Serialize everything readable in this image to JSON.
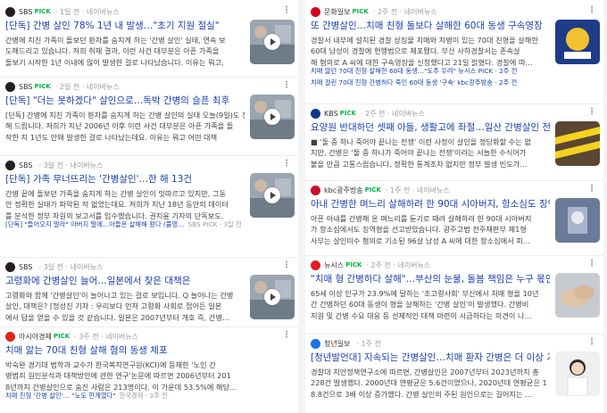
{
  "left": [
    {
      "source": "SBS",
      "pick": "PICK",
      "meta": "· 1일 전 · 네이버뉴스",
      "title": "[단독] 간병 살인 78% 1년 내 발생…\"초기 지원 절실\"",
      "lines": [
        "간병에 지친 가족이 돌보던 환자를 숨지게 하는 '간병 살인' 실태, 연속 보",
        "도해드리고 있습니다. 저희 취재 결과, 이런 사건 대부분은 아픈 가족을",
        "돌보기 시작한 1년 이내에 많이 발생한 걸로 나타났습니다. 이유는 뭐고,"
      ],
      "thumb": "video",
      "logo_color": "#231f20"
    },
    {
      "source": "SBS",
      "pick": "PICK",
      "meta": "· 2일 전 · 네이버뉴스",
      "title": "[단독] \"더는 못하겠다\" 살인으로…독박 간병의 슬픈 최후",
      "lines": [
        "[단독] 간병에 지친 가족이 환자를 숨지게 하는 간병 살인의 실태 오늘(9일)도 전",
        "해 드립니다. 저희가 지난 2006년 이후 이런 사건 대부분은 아픈 가족을 돌",
        "작한 지 1년도 안돼 발생한 걸로 나타났는데요. 이유는 뭐고 어떤 대책"
      ],
      "thumb": "video",
      "logo_color": "#231f20"
    },
    {
      "source": "SBS",
      "pick": "",
      "meta": "· 3일 전 · 네이버뉴스",
      "title": "[단독] 가족 무너뜨리는 '간병살인'…한 해 13건",
      "lines": [
        "간병 끝에 돌보던 가족을 숨지게 하는 간병 살인이 잇따르고 있지만, 그동",
        "안 정확한 실태가 파악된 적 없었는데요. 저희가 지난 18년 동안의 데이터",
        "를 분석한 정부 자원의 보고서를 입수했습니다. 권지윤 기자의 단독보도."
      ],
      "related": "[단독] \"들어오지 말라\" 아버지 말에…아들은 살해해 왔다 (풀영…",
      "related_meta": "SBS PICK · 3일 전",
      "thumb": "video",
      "logo_color": "#231f20"
    },
    {
      "source": "SBS",
      "pick": "",
      "meta": "· 3일 전 · 네이버뉴스",
      "title": "고령화에 간병살인 늘어…일본에서 찾은 대책은",
      "lines": [
        "고령화와 함께 '간병살인'이 늘어나고 있는 걸로 보입니다. Q 늘어나는 간병",
        "살인, 대책은? [정성진 기자 : 우리보다 먼저 고령화 사회로 접어든 일본",
        "에서 답을 얻을 수 있을 것 같습니다. 일본은 2007년부터 개호 즉, 간병…"
      ],
      "thumb": "video",
      "logo_color": "#231f20"
    },
    {
      "source": "아시아경제",
      "pick": "PICK",
      "meta": "· 3주 전 · 네이버뉴스",
      "title": "치매 앓는 70대 친형 살해 혐의 동생 체포",
      "lines": [
        "박숙완 경기대 법학과 교수가 한국복지연구원(KCI)에 등재한 '노인 간",
        "병범죄 원인분석과 대책방안에 관한 연구'논문에 따르면 2006년부터 201",
        "8년까지 간병살인으로 숨진 사람은 213명이다. 이 가운데 53.5%에 해당…"
      ],
      "related": "치매 친형 '간병 살인'… \"노도 한계였다\"",
      "related_meta": "한국경제 · 3주 전",
      "thumb": "none",
      "logo_color": "#e2231a"
    }
  ],
  "right": [
    {
      "source": "문화일보",
      "pick": "PICK",
      "meta": "· 2주 전 · 네이버뉴스",
      "title": "또 간병살인…치매 친형 돌보다 살해한 60대 동생 구속영장",
      "lines": [
        "경찰서 내부에 설치된 경찰 상징물 치매와 지병이 있는 70대 친형을 살해한",
        "60대 남성이 경찰에 현행범으로 체포됐다. 부산 사하경찰서는 존속살",
        "해 혐의로 A 씨에 대한 구속영장을 신청했다고 21일 밝혔다. 경찰에 따…"
      ],
      "related": "치매 앓던 70대 친형 살해한 60대 동생…\"도주 우려\" 뉴시스 PICK · 2주 전",
      "related2": "치매 걸린 70대 친형 간병하다 죽인 60대 동생 '구속' kbc광주방송 · 2주 전",
      "thumb": "police",
      "logo_color": "#d9001b"
    },
    {
      "source": "KBS",
      "pick": "PICK",
      "meta": "· 2주 전 · 네이버뉴스",
      "title": "요양원 반대하던 셋째 아들, 생활고에 좌절…일산 간병살인 전모",
      "lines": [
        "■ '둘 중 하나 죽어야 끝나는 전쟁' 이런 사정이 살인을 정당화할 수는 없",
        "지만, 간병은 '둘 중 하나가 죽어야 끝나는 전쟁'이라는 서늘한 수식어가",
        "붙을 만큼 고통스럽습니다. 정확한 통계조차 없지만 정부 발생 빈도가…"
      ],
      "thumb": "tape",
      "logo_color": "#0d3b88"
    },
    {
      "source": "kbc광주방송",
      "pick": "PICK",
      "meta": "· 1주 전 · 네이버뉴스",
      "title": "아내 간병한 며느리 살해하려 한 90대 시아버지, 항소심도 징역…",
      "lines": [
        "아픈 아내를 간병해 온 며느리를 둔기로 때려 살해하려 한 90대 시아버지",
        "가 항소심에서도 징역형을 선고받았습니다. 광주고법 전주재판부 제1형",
        "사부는 살인미수 혐의로 기소된 96살 남성 A 씨에 대한 항소심에서 피…"
      ],
      "thumb": "court",
      "logo_color": "#c8102e"
    },
    {
      "source": "뉴시스",
      "pick": "PICK",
      "meta": "· 2주 전 · 네이버뉴스",
      "title": "\"치매 형 간병하다 살해\"…부산의 눈물, 돌봄 책임은 누구 몫인가",
      "lines": [
        "65세 이상 인구가 23.9%에 달하는 '초고령사회' 부산에서 치매 형을 10년",
        "간 간병하던 60대 동생이 형을 살해하는 '간병 살인'이 발생했다. 간병비",
        "지원 및 간병 수요 대응 등 선제적인 대책 마련이 시급하다는 의견이 나…"
      ],
      "thumb": "hand",
      "logo_color": "#e31b23"
    },
    {
      "source": "청년일보",
      "pick": "",
      "meta": "· 1주 전",
      "title": "[청년발언대] 지속되는 간병살인…치매 환자 간병은 더 이상 가…",
      "lines": [
        "경찰대 치안정책연구소에 따르면, 간병살인은 2007년부터 2023년까지 총",
        "228건 발생했다. 2000년대 연평균은 5.6건이었으나, 2020년대 연평균은 1",
        "8.8건으로 3배 이상 증가했다. 간병 살인의 주된 원인으로는 길어지는 …"
      ],
      "thumb": "person",
      "logo_color": "#1a73e8"
    }
  ],
  "colors": {
    "title": "#1a3fae",
    "pick": "#00b843",
    "meta": "#999999"
  },
  "icons": [
    "more-icon",
    "play-icon"
  ]
}
